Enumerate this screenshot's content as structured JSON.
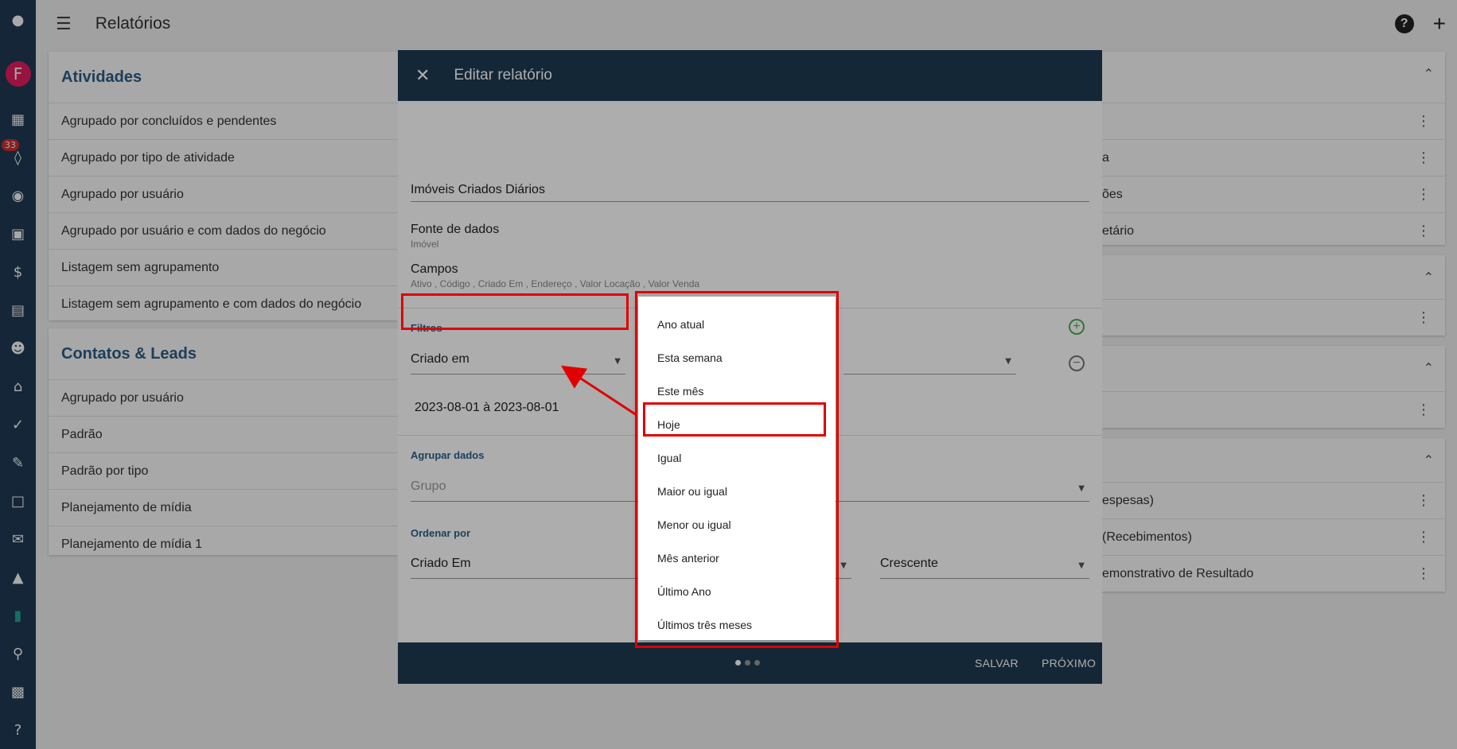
{
  "app": {
    "page_title": "Relatórios",
    "notifications_count": "33",
    "user_initial": "F"
  },
  "left_cards": [
    {
      "title": "Atividades",
      "items": [
        "Agrupado por concluídos e pendentes",
        "Agrupado por tipo de atividade",
        "Agrupado por usuário",
        "Agrupado por usuário e com dados do negócio",
        "Listagem sem agrupamento",
        "Listagem sem agrupamento e com dados do negócio"
      ]
    },
    {
      "title": "Contatos & Leads",
      "items": [
        "Agrupado por usuário",
        "Padrão",
        "Padrão por tipo",
        "Planejamento de mídia",
        "Planejamento de mídia 1"
      ]
    }
  ],
  "right_fragments": [
    "a",
    "ões",
    "etário",
    "espesas)",
    "(Recebimentos)",
    "emonstrativo de Resultado"
  ],
  "dialog": {
    "title": "Editar relatório",
    "report_name": "Imóveis Criados Diários",
    "data_source_label": "Fonte de dados",
    "data_source_value": "Imóvel",
    "fields_label": "Campos",
    "fields_value": "Ativo , Código , Criado Em , Endereço , Valor Locação , Valor Venda",
    "filters_label": "Filtros",
    "filter_field": "Criado em",
    "filter_date_start": "2023-08-01",
    "filter_date_sep": "à",
    "filter_date_end": "2023-08-01",
    "group_label": "Agrupar dados",
    "group_placeholder": "Grupo",
    "order_label": "Ordenar por",
    "order_field": "Criado Em",
    "order_direction": "Crescente",
    "save_label": "SALVAR",
    "next_label": "PRÓXIMO"
  },
  "dropdown": {
    "options": [
      "Ano atual",
      "Esta semana",
      "Este mês",
      "Hoje",
      "Igual",
      "Maior ou igual",
      "Menor ou igual",
      "Mês anterior",
      "Último Ano",
      "Últimos três meses"
    ],
    "highlighted": "Hoje"
  },
  "colors": {
    "accent": "#1d3a52",
    "highlight": "#e00000",
    "link": "#2c5f8a"
  }
}
